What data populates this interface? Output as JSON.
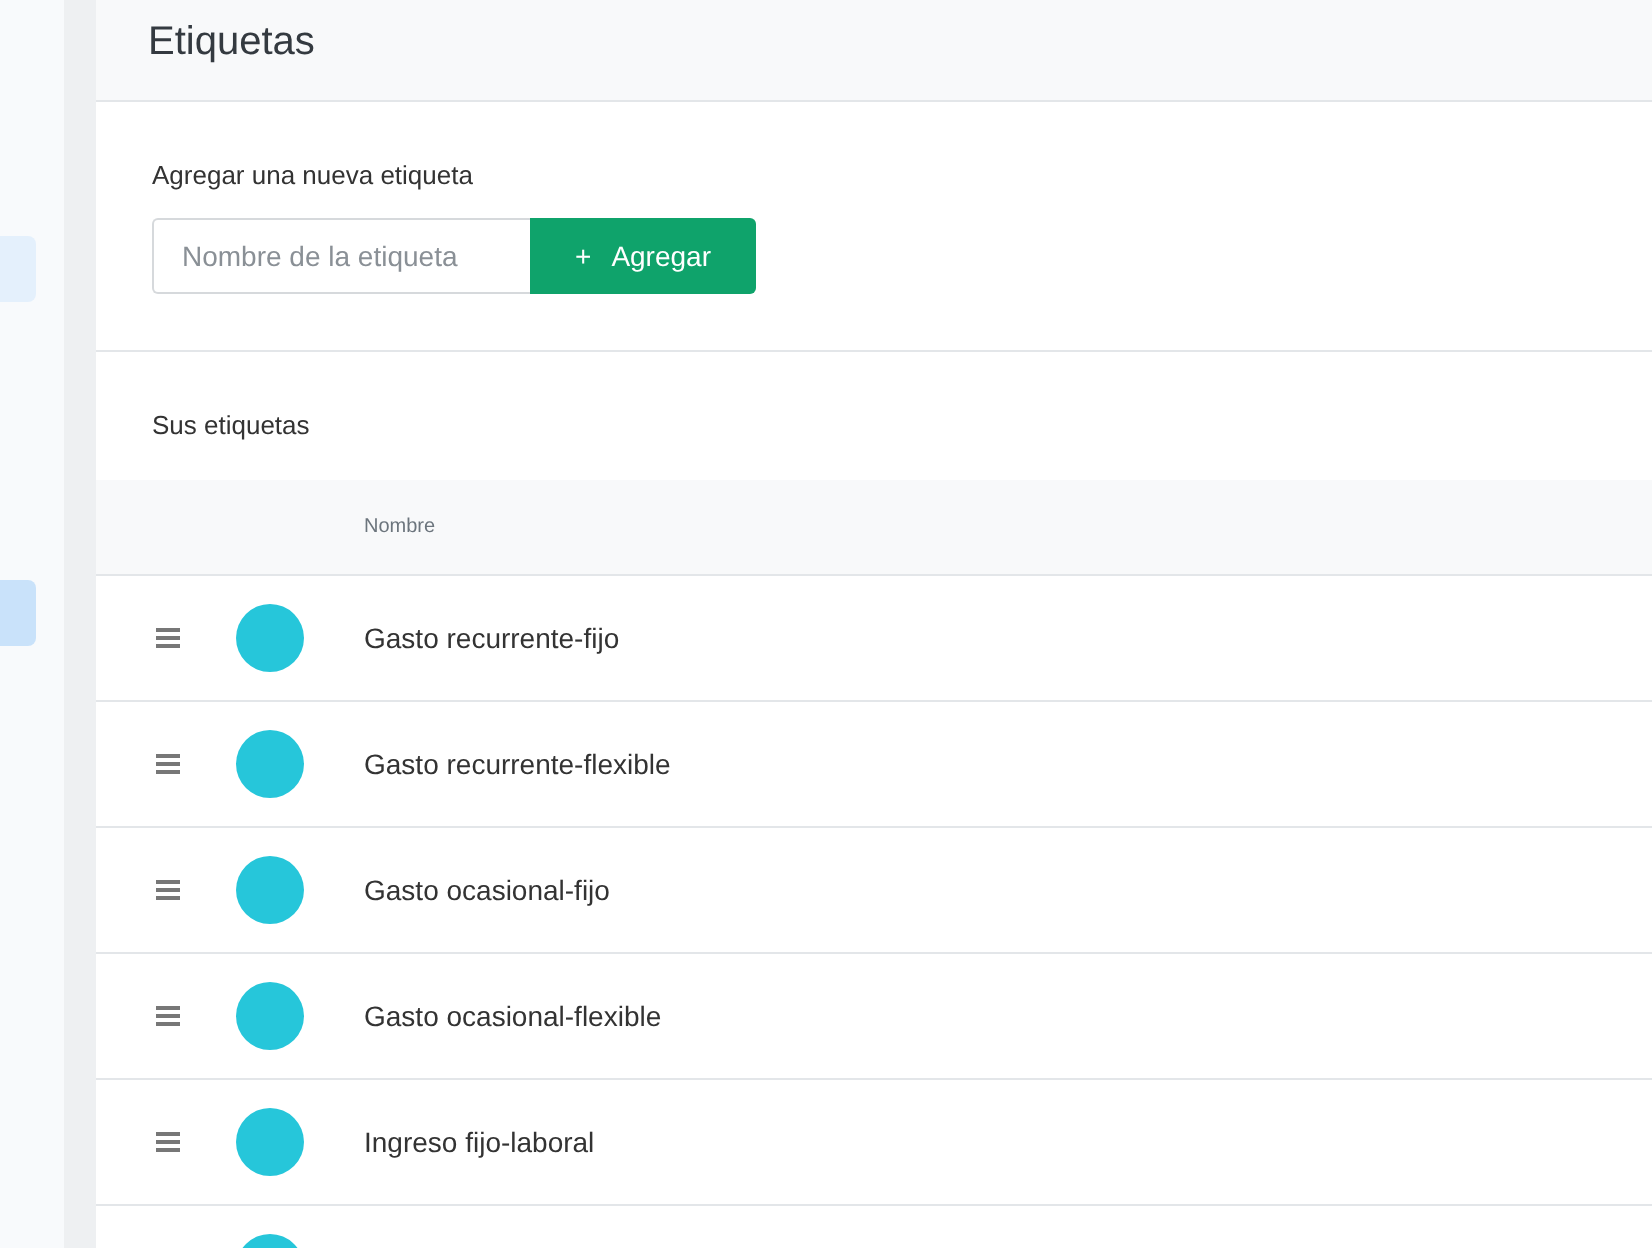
{
  "sidebar": {
    "items": [
      {
        "selected": false
      },
      {
        "selected": true
      }
    ]
  },
  "page": {
    "title": "Etiquetas"
  },
  "add_form": {
    "label": "Agregar una nueva etiqueta",
    "input": {
      "placeholder": "Nombre de la etiqueta"
    },
    "button": {
      "icon": "+",
      "label": "Agregar"
    }
  },
  "tags_table": {
    "title": "Sus etiquetas",
    "columns": [
      "Nombre"
    ],
    "rows": [
      {
        "color": "#26c6da",
        "name": "Gasto recurrente-fijo"
      },
      {
        "color": "#26c6da",
        "name": "Gasto recurrente-flexible"
      },
      {
        "color": "#26c6da",
        "name": "Gasto ocasional-fijo"
      },
      {
        "color": "#26c6da",
        "name": "Gasto ocasional-flexible"
      },
      {
        "color": "#26c6da",
        "name": "Ingreso fijo-laboral"
      },
      {
        "color": "#26c6da"
      }
    ]
  }
}
